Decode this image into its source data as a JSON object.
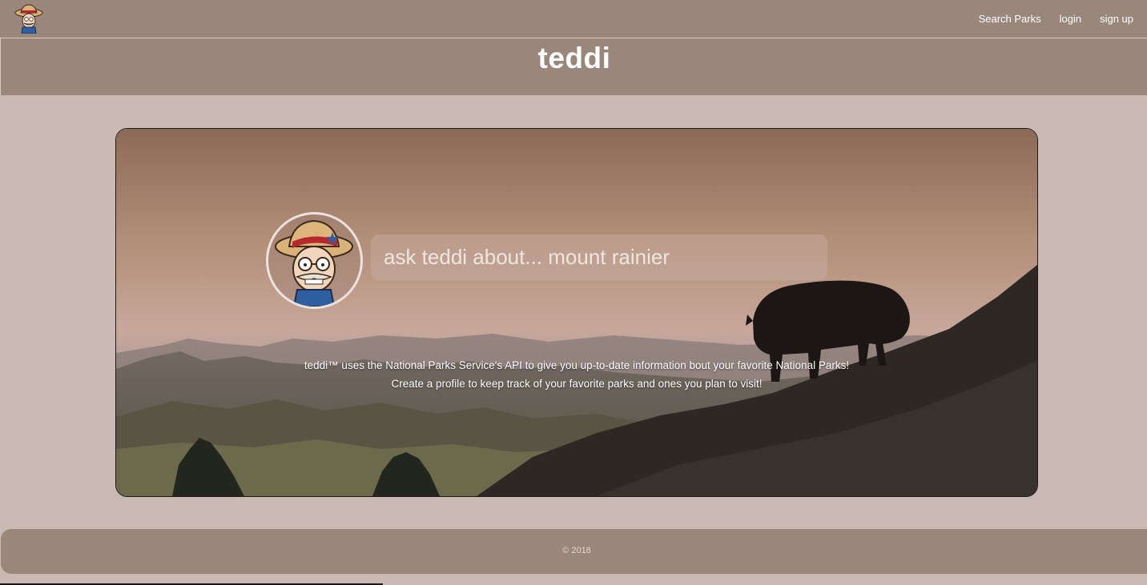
{
  "nav": {
    "logo_icon": "teddi-logo-icon",
    "links": {
      "search_parks": "Search Parks",
      "login": "login",
      "signup": "sign up"
    }
  },
  "header": {
    "title": "teddi"
  },
  "hero": {
    "avatar_icon": "teddi-avatar-icon",
    "background_image": "bison-badlands-sunset",
    "search": {
      "placeholder": "ask teddi about... mount rainier",
      "value": ""
    },
    "description_line1": "teddi™ uses the National Parks Service's API to give you up-to-date information bout your favorite National Parks!",
    "description_line2": "Create a profile to keep track of your favorite parks and ones you plan to visit!"
  },
  "footer": {
    "copyright": "© 2018"
  },
  "colors": {
    "bar": "#9a877c",
    "page_bg": "#c8bab2",
    "text": "#ffffff"
  }
}
